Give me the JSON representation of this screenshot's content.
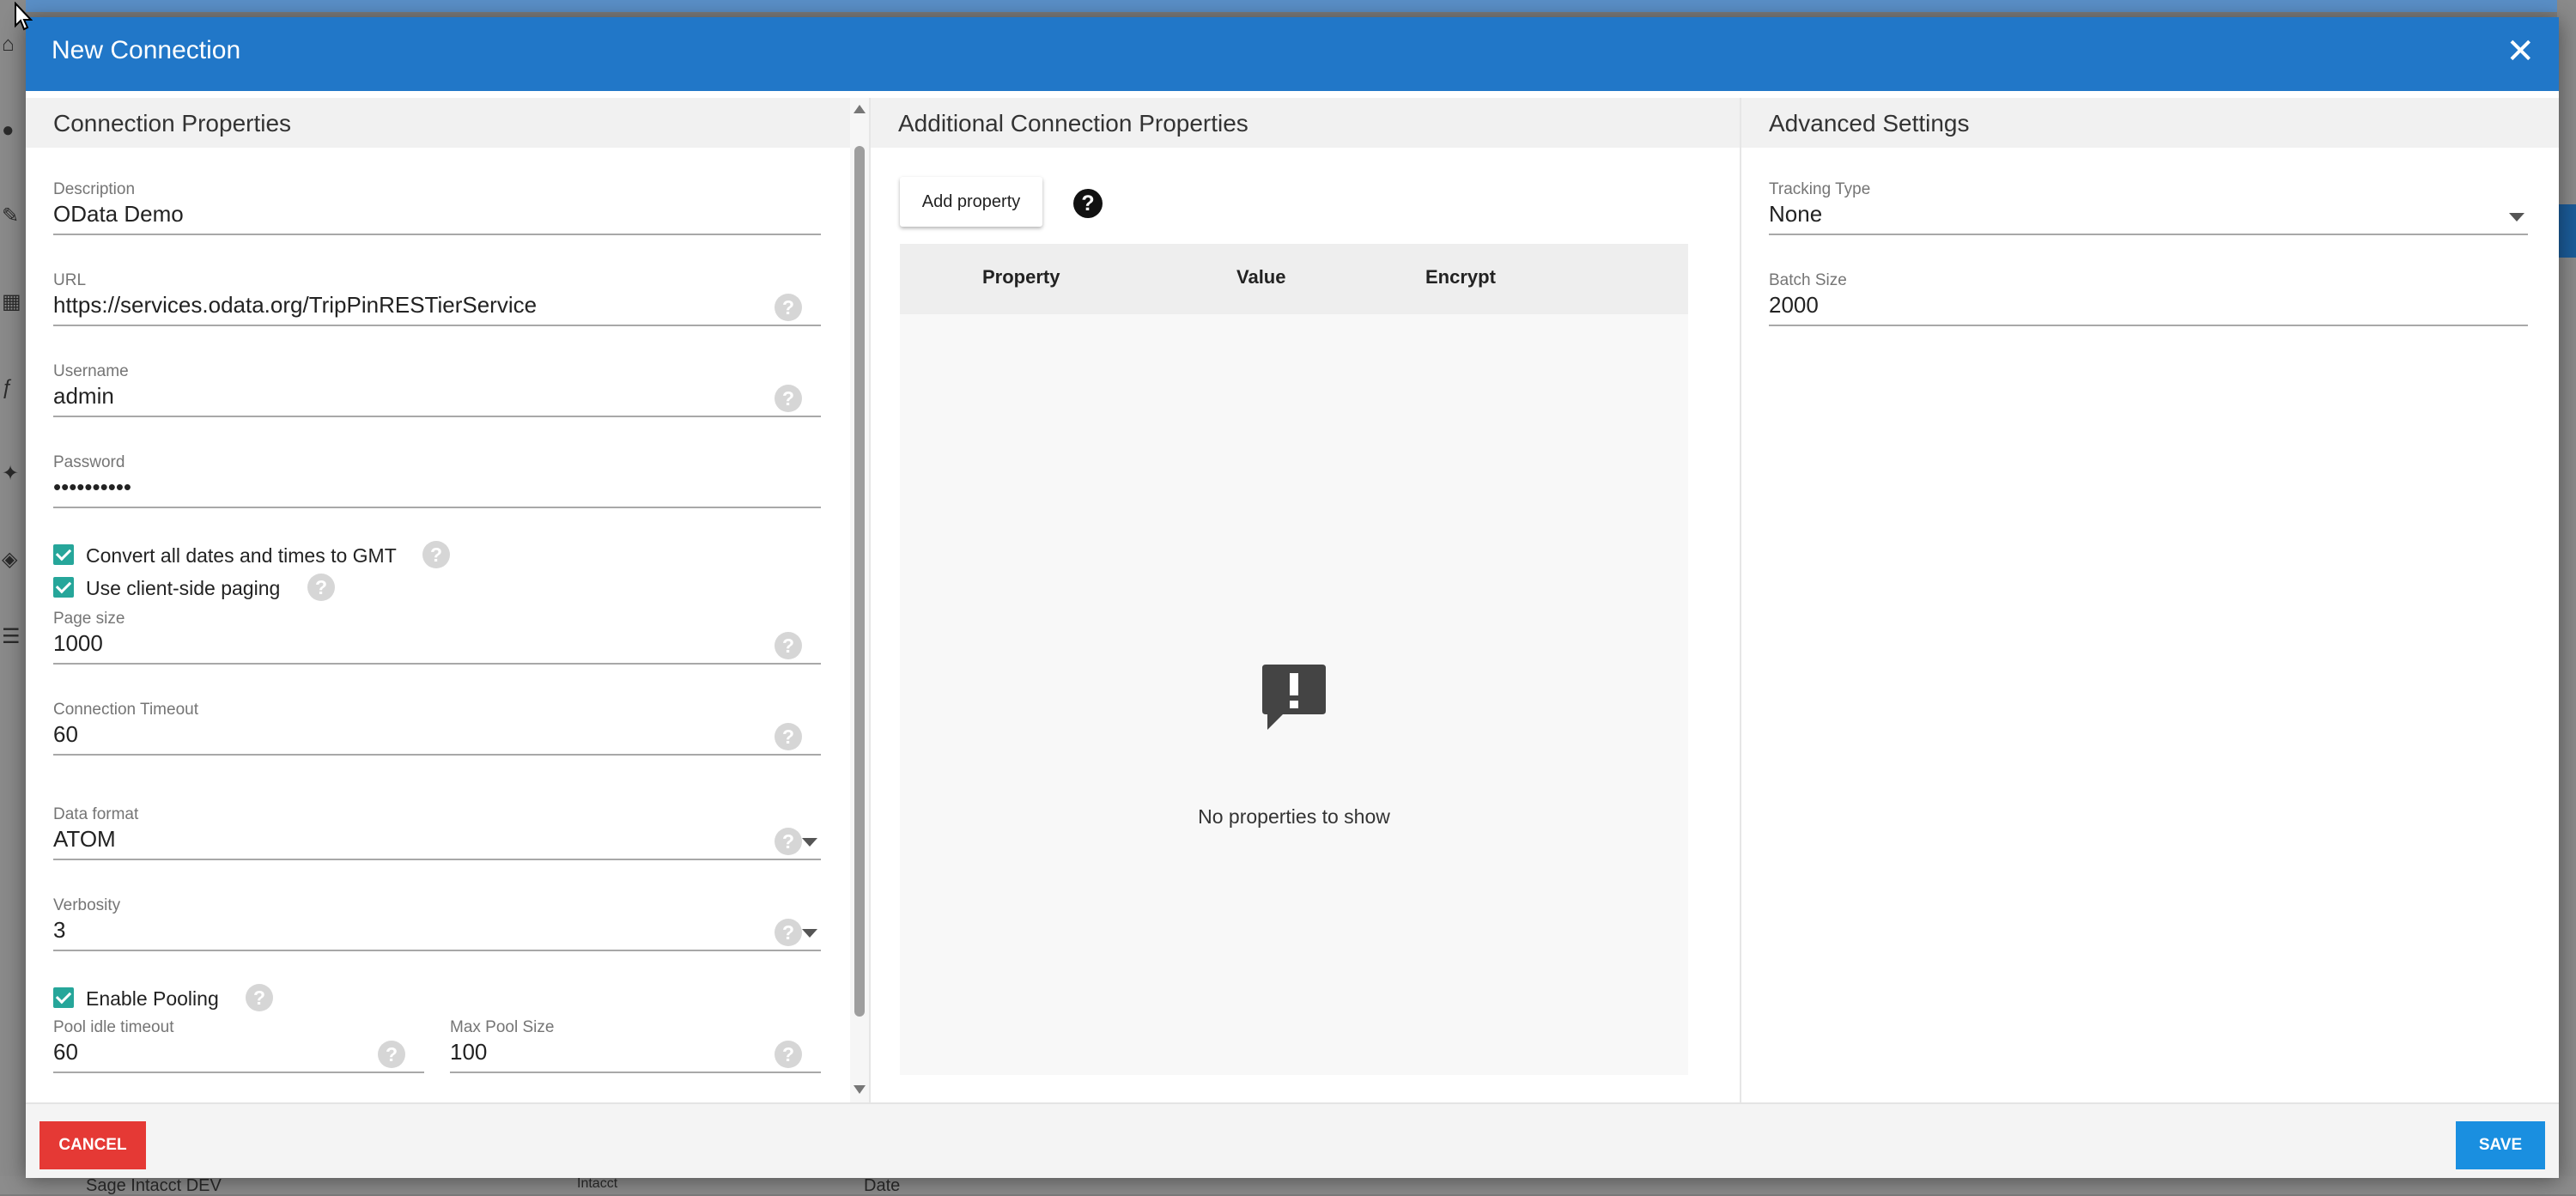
{
  "dialog": {
    "title": "New Connection"
  },
  "connection_properties": {
    "heading": "Connection Properties",
    "description": {
      "label": "Description",
      "value": "OData Demo"
    },
    "url": {
      "label": "URL",
      "value": "https://services.odata.org/TripPinRESTierService"
    },
    "username": {
      "label": "Username",
      "value": "admin"
    },
    "password": {
      "label": "Password",
      "value": "••••••••••"
    },
    "convert_dates": {
      "label": "Convert all dates and times to GMT",
      "checked": true
    },
    "client_paging": {
      "label": "Use client-side paging",
      "checked": true
    },
    "page_size": {
      "label": "Page size",
      "value": "1000"
    },
    "connection_timeout": {
      "label": "Connection Timeout",
      "value": "60"
    },
    "data_format": {
      "label": "Data format",
      "value": "ATOM"
    },
    "verbosity": {
      "label": "Verbosity",
      "value": "3"
    },
    "enable_pooling": {
      "label": "Enable Pooling",
      "checked": true
    },
    "pool_idle_timeout": {
      "label": "Pool idle timeout",
      "value": "60"
    },
    "max_pool_size": {
      "label": "Max Pool Size",
      "value": "100"
    }
  },
  "additional_properties": {
    "heading": "Additional Connection Properties",
    "add_button": "Add property",
    "columns": [
      "Property",
      "Value",
      "Encrypt"
    ],
    "empty_text": "No properties to show"
  },
  "advanced_settings": {
    "heading": "Advanced Settings",
    "tracking_type": {
      "label": "Tracking Type",
      "value": "None"
    },
    "batch_size": {
      "label": "Batch Size",
      "value": "2000"
    }
  },
  "footer": {
    "cancel": "CANCEL",
    "save": "SAVE"
  },
  "background": {
    "row_name": "Sage Intacct DEV",
    "col_intacct": "Intacct",
    "col_date": "Date"
  },
  "icons": {
    "help": "?",
    "close": "✕",
    "help_dark": "?"
  },
  "colors": {
    "header": "#2177c8",
    "cancel": "#e53935",
    "save": "#1a8fe0",
    "checkbox": "#26a69a"
  }
}
